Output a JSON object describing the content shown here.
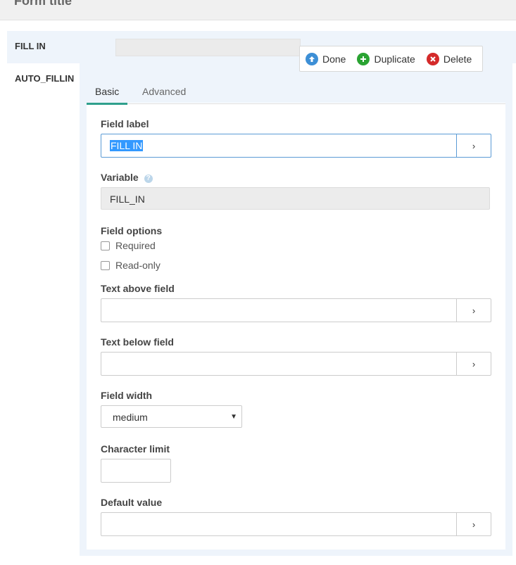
{
  "header": {
    "title": "Form title"
  },
  "field_list": {
    "active": "FILL IN",
    "items": [
      "AUTO_FILLIN"
    ]
  },
  "actions": {
    "done": "Done",
    "duplicate": "Duplicate",
    "delete": "Delete"
  },
  "tabs": {
    "basic": "Basic",
    "advanced": "Advanced"
  },
  "form": {
    "field_label": {
      "label": "Field label",
      "value": "FILL IN",
      "button": "›"
    },
    "variable": {
      "label": "Variable",
      "help": "?",
      "value": "FILL_IN"
    },
    "field_options": {
      "label": "Field options",
      "required": "Required",
      "read_only": "Read-only"
    },
    "text_above": {
      "label": "Text above field",
      "value": "",
      "button": "›"
    },
    "text_below": {
      "label": "Text below field",
      "value": "",
      "button": "›"
    },
    "field_width": {
      "label": "Field width",
      "value": "medium"
    },
    "character_limit": {
      "label": "Character limit",
      "value": ""
    },
    "default_value": {
      "label": "Default value",
      "value": "",
      "button": "›"
    }
  },
  "colors": {
    "accent_tab": "#2fa08c",
    "done": "#3d8fd6",
    "duplicate": "#2aa332",
    "delete": "#d42a2a",
    "panel_bg": "#eef4fb"
  }
}
